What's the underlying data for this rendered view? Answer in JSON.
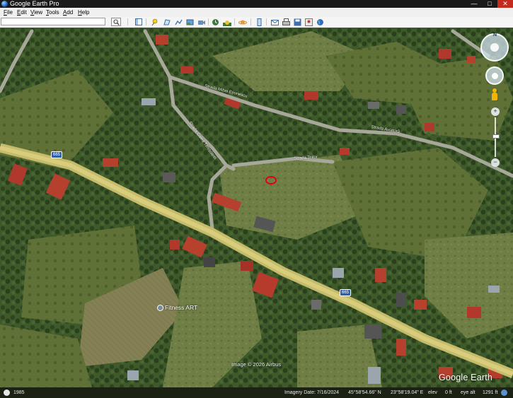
{
  "window": {
    "title": "Google Earth Pro",
    "controls": [
      "—",
      "□",
      "✕"
    ]
  },
  "menu": {
    "items": [
      "File",
      "Edit",
      "View",
      "Tools",
      "Add",
      "Help"
    ],
    "accelerators": [
      "F",
      "E",
      "V",
      "T",
      "A",
      "H"
    ]
  },
  "toolbar": {
    "search_value": "",
    "search_icon": "magnifier-icon",
    "buttons": [
      {
        "name": "sidebar-toggle",
        "icon": "sidebar-icon"
      },
      {
        "name": "add-placemark",
        "icon": "pushpin-icon"
      },
      {
        "name": "add-polygon",
        "icon": "polygon-icon"
      },
      {
        "name": "add-path",
        "icon": "path-icon"
      },
      {
        "name": "add-image-overlay",
        "icon": "image-overlay-icon"
      },
      {
        "name": "record-tour",
        "icon": "tour-icon"
      },
      {
        "name": "historical-imagery",
        "icon": "clock-icon"
      },
      {
        "name": "sunlight",
        "icon": "sun-icon"
      },
      {
        "name": "switch-to-sky",
        "icon": "planet-icon"
      },
      {
        "name": "ruler",
        "icon": "ruler-icon"
      },
      {
        "name": "email",
        "icon": "envelope-icon"
      },
      {
        "name": "print",
        "icon": "printer-icon"
      },
      {
        "name": "save-image",
        "icon": "save-image-icon"
      },
      {
        "name": "view-in-google-maps",
        "icon": "maps-icon"
      },
      {
        "name": "earth-gallery",
        "icon": "globe-icon"
      }
    ]
  },
  "map": {
    "road_labels": [
      "Strada Mihai Eminescu",
      "Strada Calea Timișoarei",
      "Strada Aviatorâ",
      "Strada Teilor"
    ],
    "route_shields": [
      "665",
      "665"
    ],
    "poi": {
      "label": "Fitness ART",
      "icon": "poi-pin-icon"
    },
    "imagery_credit": "Image © 2026 Airbus",
    "logo": "Google Earth",
    "marker_color": "#e0001a"
  },
  "nav_controls": {
    "compass_north": "N",
    "zoom_in": "+",
    "zoom_out": "−"
  },
  "status": {
    "history_year": "1985",
    "imagery_date": "Imagery Date: 7/16/2024",
    "latitude": "45°58'54.66\" N",
    "longitude": "23°58'19.04\" E",
    "elevation": "elev",
    "elevation_value": "0 ft",
    "eye_alt": "eye alt",
    "eye_alt_value": "1291 ft"
  }
}
